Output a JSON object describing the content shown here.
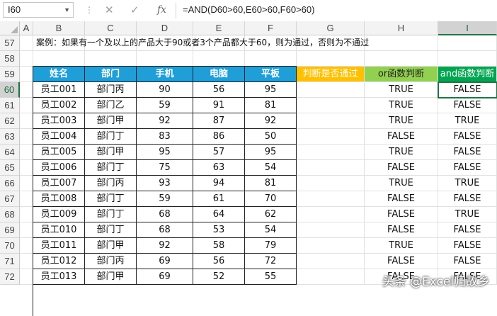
{
  "formula_bar": {
    "name_box": "I60",
    "cancel_icon": "cancel-icon",
    "enter_icon": "checkmark-icon",
    "fx_label": "fx",
    "formula": "=AND(D60>60,E60>60,F60>60)"
  },
  "columns": [
    "A",
    "B",
    "C",
    "D",
    "E",
    "F",
    "G",
    "H",
    "I"
  ],
  "selected_cell": "I60",
  "row_numbers": [
    "57",
    "58",
    "59",
    "60",
    "61",
    "62",
    "63",
    "64",
    "65",
    "66",
    "67",
    "68",
    "69",
    "70",
    "71",
    "72"
  ],
  "note": "案例：如果有一个及以上的产品大于90或者3个产品都大于60，则为通过，否则为不通过",
  "headers": {
    "name": "姓名",
    "dept": "部门",
    "phone": "手机",
    "computer": "电脑",
    "tablet": "平板",
    "judge": "判断是否通过",
    "or_judge": "or函数判断",
    "and_judge": "and函数判断"
  },
  "rows": [
    {
      "name": "员工001",
      "dept": "部门丙",
      "phone": "90",
      "computer": "56",
      "tablet": "95",
      "or": "TRUE",
      "and": "FALSE"
    },
    {
      "name": "员工002",
      "dept": "部门乙",
      "phone": "59",
      "computer": "91",
      "tablet": "81",
      "or": "TRUE",
      "and": "FALSE"
    },
    {
      "name": "员工003",
      "dept": "部门甲",
      "phone": "92",
      "computer": "87",
      "tablet": "92",
      "or": "TRUE",
      "and": "TRUE"
    },
    {
      "name": "员工004",
      "dept": "部门丁",
      "phone": "83",
      "computer": "86",
      "tablet": "50",
      "or": "FALSE",
      "and": "FALSE"
    },
    {
      "name": "员工005",
      "dept": "部门甲",
      "phone": "95",
      "computer": "57",
      "tablet": "95",
      "or": "TRUE",
      "and": "FALSE"
    },
    {
      "name": "员工006",
      "dept": "部门丁",
      "phone": "75",
      "computer": "63",
      "tablet": "54",
      "or": "FALSE",
      "and": "FALSE"
    },
    {
      "name": "员工007",
      "dept": "部门丙",
      "phone": "93",
      "computer": "94",
      "tablet": "81",
      "or": "TRUE",
      "and": "TRUE"
    },
    {
      "name": "员工008",
      "dept": "部门丁",
      "phone": "59",
      "computer": "61",
      "tablet": "70",
      "or": "FALSE",
      "and": "FALSE"
    },
    {
      "name": "员工009",
      "dept": "部门丁",
      "phone": "68",
      "computer": "64",
      "tablet": "62",
      "or": "FALSE",
      "and": "TRUE"
    },
    {
      "name": "员工010",
      "dept": "部门丁",
      "phone": "68",
      "computer": "53",
      "tablet": "54",
      "or": "FALSE",
      "and": "FALSE"
    },
    {
      "name": "员工011",
      "dept": "部门甲",
      "phone": "92",
      "computer": "58",
      "tablet": "79",
      "or": "TRUE",
      "and": "FALSE"
    },
    {
      "name": "员工012",
      "dept": "部门丙",
      "phone": "69",
      "computer": "56",
      "tablet": "72",
      "or": "FALSE",
      "and": "FALSE"
    },
    {
      "name": "员工013",
      "dept": "部门甲",
      "phone": "69",
      "computer": "52",
      "tablet": "55",
      "or": "FALSE",
      "and": "FALSE"
    }
  ],
  "watermark": "头条 @Excel归故乡",
  "colors": {
    "header_blue": "#1f9ed8",
    "header_orange": "#ffc000",
    "header_green": "#92d050",
    "header_dark_green": "#00a550",
    "selection": "#217346"
  }
}
